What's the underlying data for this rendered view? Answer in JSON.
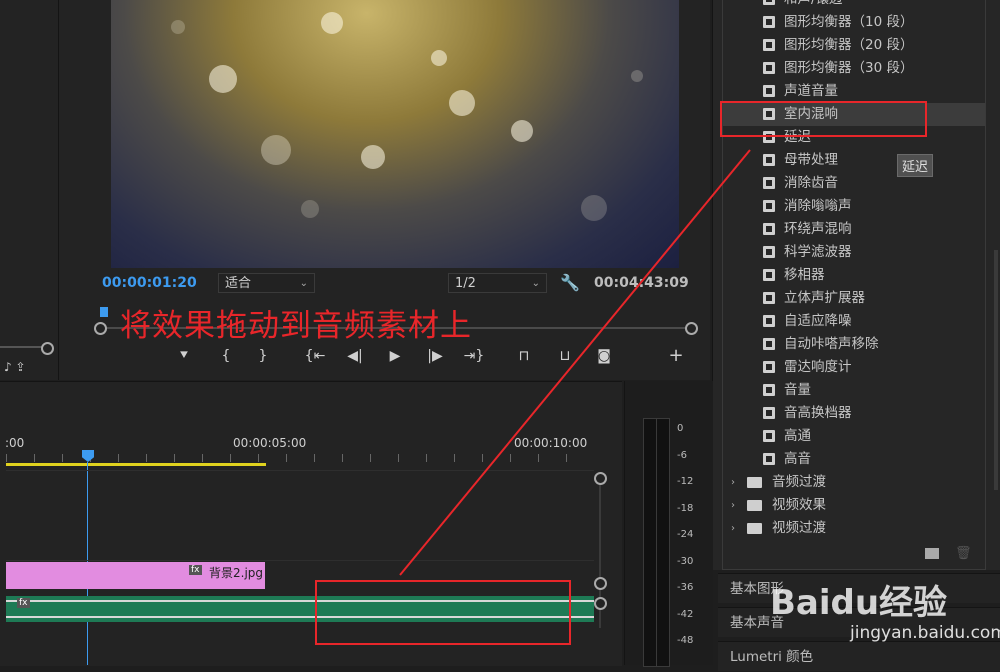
{
  "monitor": {
    "current_time": "00:00:01:20",
    "fit_select": "适合",
    "resolution_select": "1/2",
    "duration": "00:04:43:09"
  },
  "annotation": {
    "instruction": "将效果拖动到音频素材上",
    "color": "#e8262a"
  },
  "effects": {
    "items": [
      {
        "label": "和声/镶边",
        "icon": "effect-preset-icon"
      },
      {
        "label": "图形均衡器（10 段）",
        "icon": "effect-preset-icon"
      },
      {
        "label": "图形均衡器（20 段）",
        "icon": "effect-preset-icon"
      },
      {
        "label": "图形均衡器（30 段）",
        "icon": "effect-preset-icon"
      },
      {
        "label": "声道音量",
        "icon": "effect-preset-icon"
      },
      {
        "label": "室内混响",
        "icon": "effect-preset-icon"
      },
      {
        "label": "延迟",
        "icon": "effect-preset-icon"
      },
      {
        "label": "母带处理",
        "icon": "effect-preset-icon"
      },
      {
        "label": "消除齿音",
        "icon": "effect-preset-icon"
      },
      {
        "label": "消除嗡嗡声",
        "icon": "effect-preset-icon"
      },
      {
        "label": "环绕声混响",
        "icon": "effect-preset-icon"
      },
      {
        "label": "科学滤波器",
        "icon": "effect-preset-icon"
      },
      {
        "label": "移相器",
        "icon": "effect-preset-icon"
      },
      {
        "label": "立体声扩展器",
        "icon": "effect-preset-icon"
      },
      {
        "label": "自适应降噪",
        "icon": "effect-preset-icon"
      },
      {
        "label": "自动咔嗒声移除",
        "icon": "effect-preset-icon"
      },
      {
        "label": "雷达响度计",
        "icon": "effect-preset-icon"
      },
      {
        "label": "音量",
        "icon": "effect-preset-icon"
      },
      {
        "label": "音高换档器",
        "icon": "effect-preset-icon"
      },
      {
        "label": "高通",
        "icon": "effect-preset-icon"
      },
      {
        "label": "高音",
        "icon": "effect-preset-icon"
      }
    ],
    "folders": [
      {
        "label": "音频过渡",
        "icon": "folder-icon"
      },
      {
        "label": "视频效果",
        "icon": "folder-icon"
      },
      {
        "label": "视频过渡",
        "icon": "folder-icon"
      }
    ],
    "tooltip": "延迟"
  },
  "side_panels": {
    "basic_graphics": "基本图形",
    "basic_sound": "基本声音",
    "lumetri": "Lumetri 颜色"
  },
  "timeline": {
    "tick_start": ":00",
    "tick_5s": "00:00:05:00",
    "tick_10s": "00:00:10:00",
    "clip_name": "背景2.jpg",
    "fx_badge": "fx"
  },
  "meter": {
    "db_labels": [
      "0",
      "-6",
      "-12",
      "-18",
      "-24",
      "-30",
      "-36",
      "-42",
      "-48"
    ]
  },
  "watermark": {
    "brand": "Baidu经验",
    "url": "jingyan.baidu.com"
  }
}
